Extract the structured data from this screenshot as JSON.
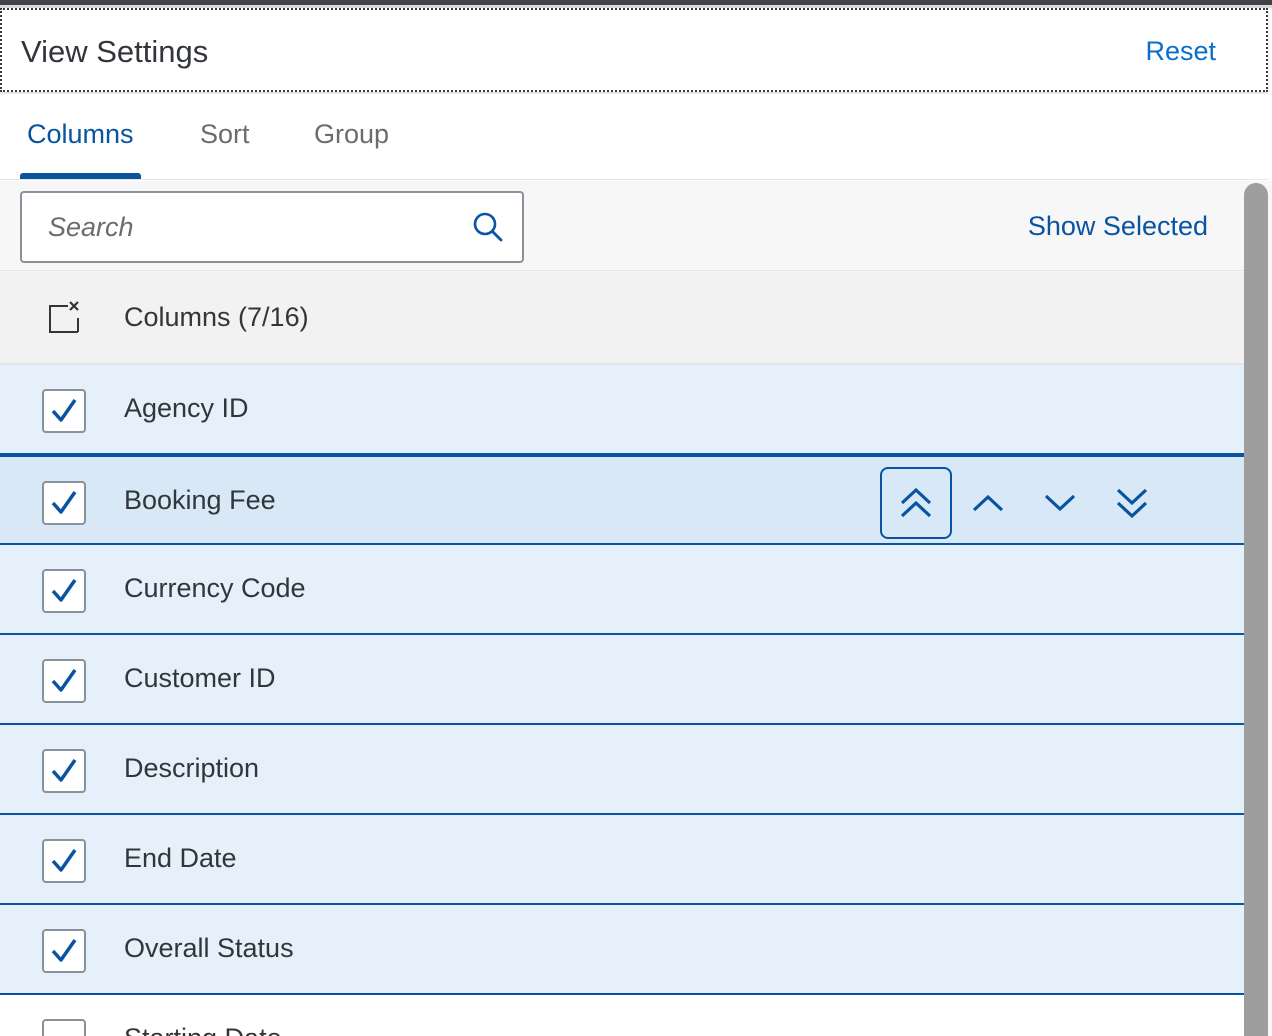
{
  "header": {
    "title": "View Settings",
    "reset_label": "Reset"
  },
  "tabs": [
    {
      "label": "Columns",
      "active": true
    },
    {
      "label": "Sort",
      "active": false
    },
    {
      "label": "Group",
      "active": false
    }
  ],
  "toolbar": {
    "search_placeholder": "Search",
    "search_icon": "search-icon",
    "show_selected_label": "Show Selected"
  },
  "list": {
    "header_label": "Columns (7/16)",
    "header_icon": "clear-selection-icon",
    "rows": [
      {
        "label": "Agency ID",
        "checked": true
      },
      {
        "label": "Booking Fee",
        "checked": true,
        "focused": true
      },
      {
        "label": "Currency Code",
        "checked": true
      },
      {
        "label": "Customer ID",
        "checked": true
      },
      {
        "label": "Description",
        "checked": true
      },
      {
        "label": "End Date",
        "checked": true
      },
      {
        "label": "Overall Status",
        "checked": true
      },
      {
        "label": "Starting Date",
        "checked": false
      }
    ],
    "move_buttons": [
      "move-to-top-icon",
      "move-up-icon",
      "move-down-icon",
      "move-to-bottom-icon"
    ]
  },
  "colors": {
    "accent": "#0854a0",
    "link": "#0a6ed1",
    "selected_row": "#e5f0fa",
    "text": "#32363a"
  }
}
